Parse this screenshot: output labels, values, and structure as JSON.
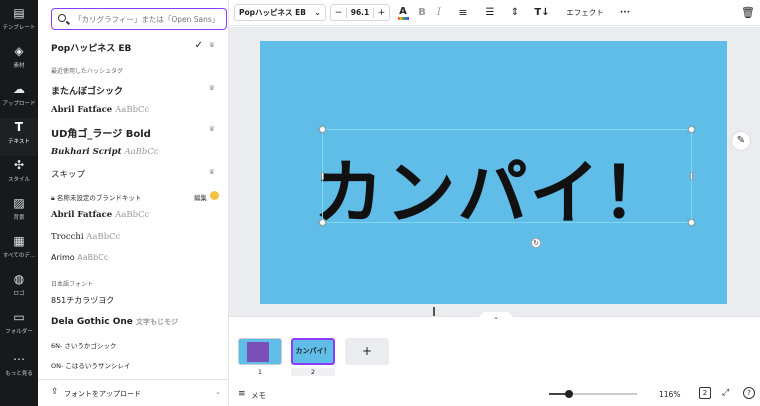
{
  "sidebar": {
    "items": [
      {
        "label": "テンプレート",
        "icon": "layout-icon"
      },
      {
        "label": "素材",
        "icon": "shapes-icon"
      },
      {
        "label": "アップロード",
        "icon": "cloud-upload-icon"
      },
      {
        "label": "テキスト",
        "icon": "text-icon"
      },
      {
        "label": "スタイル",
        "icon": "palette-icon"
      },
      {
        "label": "背景",
        "icon": "hatch-icon"
      },
      {
        "label": "すべてのデ...",
        "icon": "grid-icon"
      },
      {
        "label": "ロゴ",
        "icon": "logo-icon"
      },
      {
        "label": "フォルダー",
        "icon": "folder-icon"
      },
      {
        "label": "もっと見る",
        "icon": "more-icon"
      }
    ]
  },
  "font_panel": {
    "search_placeholder": "「カリグラフィー」または「Open Sans」",
    "selected_font": "Popハッピネス EB",
    "recent_header": "最近使用したハッシュタグ",
    "recent_fonts": [
      "またんぼゴシック",
      "Abril Fatface",
      "UD角ゴ_ラージ Bold",
      "Bukhari Script",
      "スキップ"
    ],
    "samples": {
      "abril": "AaBbCc",
      "bukhari": "AaBbCc",
      "trocchi": "AaBbCc",
      "arimo": "AaBbCc",
      "dela": "文字もじモジ"
    },
    "brand_kit_label": "名称未設定のブランドキット",
    "brand_kit_edit": "編集",
    "brand_fonts": [
      "Abril Fatface",
      "Trocchi",
      "Arimo"
    ],
    "japanese_header": "日本語フォント",
    "japanese_fonts": [
      "851チカラヅヨク",
      "Dela Gothic One",
      "6N- さいうかゴシック",
      "ON- こはるいうサンシレイ"
    ],
    "upload_label": "フォントをアップロード"
  },
  "toolbar": {
    "font_name": "Popハッピネス EB",
    "minus": "−",
    "font_size": "96.1",
    "plus": "+",
    "text_color_glyph": "A",
    "bold": "B",
    "italic": "I",
    "effects_label": "エフェクト",
    "more": "···"
  },
  "canvas": {
    "text": "カンパイ！",
    "background_color": "#5fbde8"
  },
  "pages": {
    "items": [
      {
        "number": "1"
      },
      {
        "number": "2",
        "label": "カンパイ！"
      }
    ],
    "add": "+"
  },
  "bottom": {
    "notes_label": "メモ",
    "zoom": "116%",
    "page_count": "2",
    "help": "?"
  },
  "colors": {
    "accent": "#8b3dff",
    "brand_badge": "#f6c244",
    "sidebar_bg": "#18191b"
  }
}
